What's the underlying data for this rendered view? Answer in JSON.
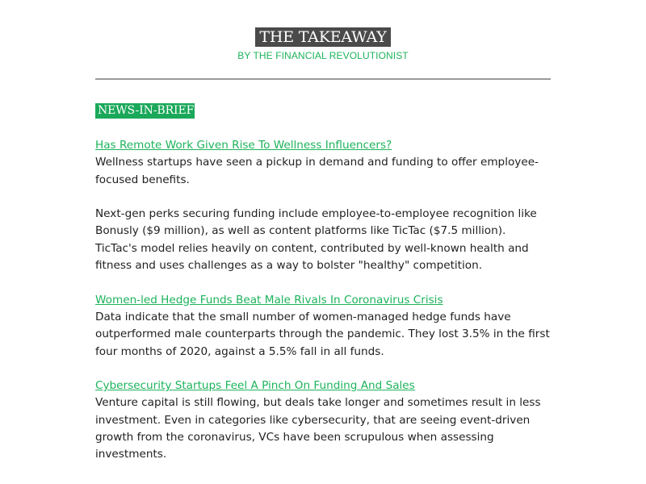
{
  "masthead": {
    "title": "THE TAKEAWAY",
    "subtitle": "BY THE FINANCIAL REVOLUTIONIST"
  },
  "section": {
    "label": "NEWS-IN-BRIEF"
  },
  "colors": {
    "accent_green": "#1db35b",
    "label_bg": "#1aa85a",
    "title_bg": "#4a4a4a",
    "rule": "#9a9a9a"
  },
  "items": [
    {
      "headline": "Has Remote Work Given Rise To Wellness Influencers?",
      "body": "Wellness startups have seen a pickup in demand and funding to offer employee-focused benefits."
    },
    {
      "headline": "",
      "body": "Next-gen perks securing funding include employee-to-employee recognition like Bonusly ($9 million), as well as content platforms like TicTac ($7.5  million). TicTac's model relies heavily on content, contributed by well-known health and fitness and uses challenges as a way to bolster \"healthy\" competition."
    },
    {
      "headline": "Women-led Hedge Funds Beat Male Rivals In Coronavirus Crisis",
      "body": "Data indicate that the small number of women-managed hedge funds have outperformed male counterparts through the pandemic. They lost 3.5% in the first four months of 2020, against a 5.5% fall in all funds."
    },
    {
      "headline": "Cybersecurity Startups Feel A Pinch On Funding And Sales",
      "body": "Venture capital is still flowing, but deals take longer and sometimes result in less investment. Even in categories like cybersecurity, that are seeing event-driven growth from the coronavirus, VCs have been scrupulous when assessing investments."
    }
  ]
}
